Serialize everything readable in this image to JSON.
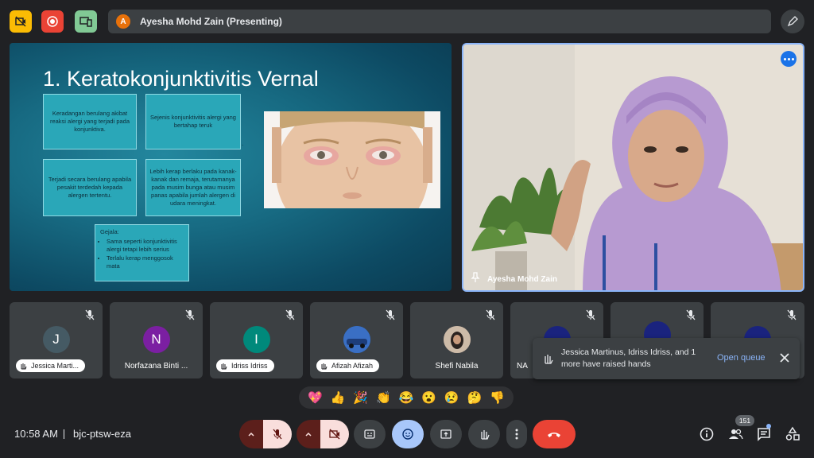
{
  "top_bar": {
    "presenter_initial": "A",
    "presenting_label": "Ayesha Mohd Zain (Presenting)"
  },
  "slide": {
    "title": "1. Keratokonjunktivitis Vernal",
    "boxes": [
      "Keradangan berulang akibat reaksi alergi yang terjadi pada konjunktiva.",
      "Sejenis konjunktivitis alergi yang bertahap teruk",
      "Terjadi secara berulang apabila pesakit terdedah kepada alergen tertentu.",
      "Lebih kerap berlaku pada kanak-kanak dan remaja, terutamanya pada musim bunga atau musim panas apabila jumlah alergen di udara meningkat."
    ],
    "symptoms_heading": "Gejala:",
    "symptoms": [
      "Sama seperti konjunktivitis alergi tetapi lebih serius",
      "Terlalu kerap menggosok mata"
    ],
    "period_mark": "."
  },
  "video": {
    "name": "Ayesha Mohd Zain"
  },
  "participants": [
    {
      "initial": "J",
      "name": "Jessica Marti...",
      "color": "#455a64",
      "hand": true
    },
    {
      "initial": "N",
      "name": "Norfazana Binti ...",
      "color": "#7b1fa2",
      "hand": false
    },
    {
      "initial": "I",
      "name": "Idriss Idriss",
      "color": "#00897b",
      "hand": true
    },
    {
      "initial": "",
      "name": "Afizah Afizah",
      "color": "#1565c0",
      "hand": true
    },
    {
      "initial": "",
      "name": "Shefi Nabila",
      "color": "#a1887f",
      "hand": false
    },
    {
      "initial": "",
      "name": "NA",
      "color": "#1a237e",
      "hand": false
    },
    {
      "initial": "",
      "name": "",
      "color": "#1a237e",
      "hand": false
    },
    {
      "initial": "",
      "name": "",
      "color": "#1a237e",
      "hand": false
    }
  ],
  "notification": {
    "text": "Jessica Martinus, Idriss Idriss, and 1 more have raised hands",
    "action": "Open queue"
  },
  "reactions": [
    "💖",
    "👍",
    "🎉",
    "👏",
    "😂",
    "😮",
    "😢",
    "🤔",
    "👎"
  ],
  "bottom_bar": {
    "time": "10:58 AM",
    "meeting_code": "bjc-ptsw-eza",
    "people_count": "151"
  }
}
